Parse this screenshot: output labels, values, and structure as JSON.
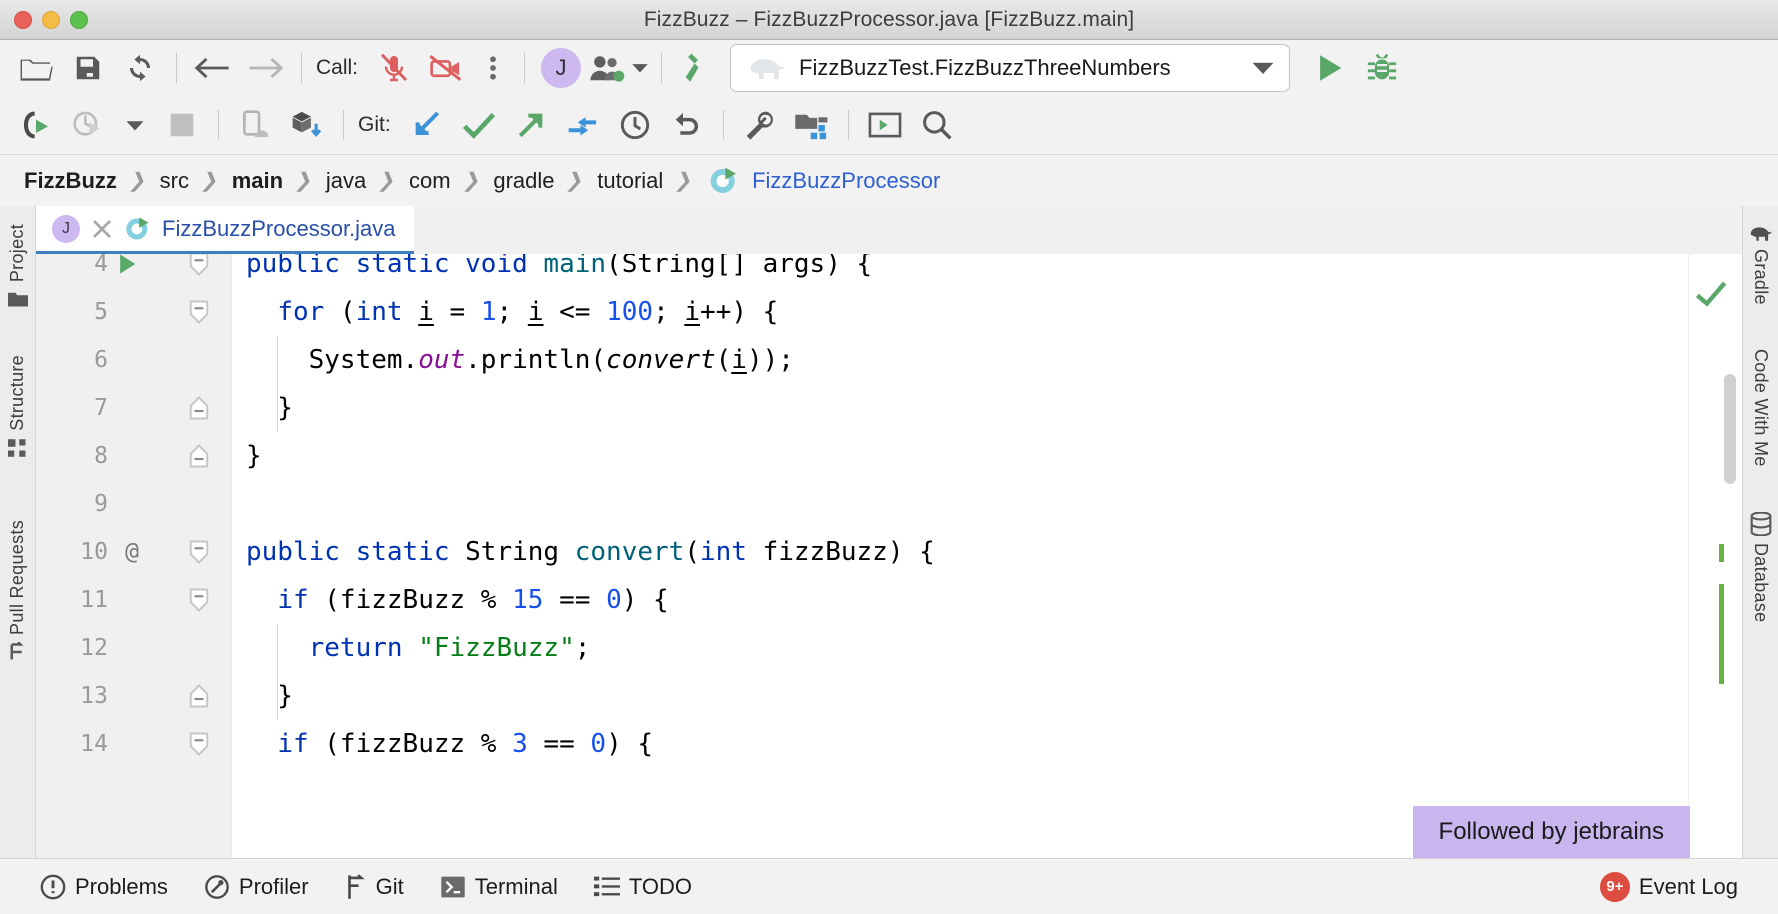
{
  "window": {
    "title": "FizzBuzz – FizzBuzzProcessor.java [FizzBuzz.main]",
    "controls": [
      "close-button",
      "minimize-button",
      "zoom-button"
    ]
  },
  "toolbar_row1": {
    "buttons": [
      {
        "name": "open-folder-icon",
        "label": "Open"
      },
      {
        "name": "save-all-icon",
        "label": "Save All"
      },
      {
        "name": "sync-icon",
        "label": "Reload All from Disk"
      },
      {
        "name": "back-arrow-icon",
        "label": "Back"
      },
      {
        "name": "forward-arrow-icon",
        "label": "Forward"
      }
    ],
    "call_label": "Call:",
    "call_buttons": [
      {
        "name": "microphone-muted-icon",
        "label": "Mute Microphone"
      },
      {
        "name": "camera-off-icon",
        "label": "Turn Off Camera"
      },
      {
        "name": "more-options-icon",
        "label": "More"
      }
    ],
    "avatar_initial": "J",
    "users_icon_label": "Code With Me Participants",
    "build_icon_label": "Build Project",
    "run_config": {
      "icon": "gradle-elephant-icon",
      "name": "FizzBuzzTest.FizzBuzzThreeNumbers",
      "dropdown": "chevron-down-icon"
    },
    "run_button_label": "Run",
    "debug_button_label": "Debug"
  },
  "toolbar_row2": {
    "buttons": [
      {
        "name": "run-with-coverage-icon",
        "label": "Run with Coverage"
      },
      {
        "name": "profiler-run-icon",
        "label": "Profile"
      },
      {
        "name": "profiler-dropdown-icon",
        "label": "Profiler Options"
      },
      {
        "name": "stop-icon",
        "label": "Stop"
      },
      {
        "name": "device-manager-icon",
        "label": "Device Manager"
      },
      {
        "name": "sdk-manager-icon",
        "label": "SDK Manager"
      }
    ],
    "git_label": "Git:",
    "git_buttons": [
      {
        "name": "git-update-icon",
        "label": "Update Project"
      },
      {
        "name": "git-commit-icon",
        "label": "Commit"
      },
      {
        "name": "git-push-icon",
        "label": "Push"
      },
      {
        "name": "git-merge-icon",
        "label": "Merge"
      },
      {
        "name": "git-history-icon",
        "label": "History"
      },
      {
        "name": "git-rollback-icon",
        "label": "Rollback"
      }
    ],
    "tail_buttons": [
      {
        "name": "settings-wrench-icon",
        "label": "Settings"
      },
      {
        "name": "project-structure-icon",
        "label": "Project Structure"
      },
      {
        "name": "terminal-icon",
        "label": "Terminal"
      },
      {
        "name": "search-icon",
        "label": "Search Everywhere"
      }
    ]
  },
  "breadcrumb": {
    "items": [
      {
        "label": "FizzBuzz",
        "style": "bold"
      },
      {
        "label": "src",
        "style": "normal"
      },
      {
        "label": "main",
        "style": "bold"
      },
      {
        "label": "java",
        "style": "normal"
      },
      {
        "label": "com",
        "style": "normal"
      },
      {
        "label": "gradle",
        "style": "normal"
      },
      {
        "label": "tutorial",
        "style": "normal"
      }
    ],
    "class_item": "FizzBuzzProcessor",
    "separator": "›"
  },
  "editor": {
    "tab": {
      "avatar_initial": "J",
      "close_label": "×",
      "filename": "FizzBuzzProcessor.java"
    },
    "lines": [
      {
        "num": "4",
        "marker": "",
        "run": true,
        "fold": "minus",
        "html": "<span class=\"kw\">public static void</span> <span class=\"meth\">main</span>(String[] args) {",
        "indent": 0
      },
      {
        "num": "5",
        "marker": "",
        "run": false,
        "fold": "minus",
        "html": "  <span class=\"kw\">for</span> (<span class=\"kw\">int</span> <span class=\"u\">i</span> = <span class=\"num\">1</span>; <span class=\"u\">i</span> &lt;= <span class=\"num\">100</span>; <span class=\"u\">i</span>++) {",
        "indent": 0
      },
      {
        "num": "6",
        "marker": "",
        "run": false,
        "fold": "",
        "html": "    System.<span class=\"italic-p\">out</span>.println(<span class=\"italic-b\">convert</span>(<span class=\"u\">i</span>));",
        "indent": 1
      },
      {
        "num": "7",
        "marker": "",
        "run": false,
        "fold": "end",
        "html": "  }",
        "indent": 1
      },
      {
        "num": "8",
        "marker": "",
        "run": false,
        "fold": "end",
        "html": "}",
        "indent": 0
      },
      {
        "num": "9",
        "marker": "",
        "run": false,
        "fold": "",
        "html": "",
        "indent": 0
      },
      {
        "num": "10",
        "marker": "@",
        "run": false,
        "fold": "minus",
        "html": "<span class=\"kw\">public static</span> String <span class=\"meth\">convert</span>(<span class=\"kw\">int</span> fizzBuzz) {",
        "indent": 0
      },
      {
        "num": "11",
        "marker": "",
        "run": false,
        "fold": "minus",
        "html": "  <span class=\"kw\">if</span> (fizzBuzz % <span class=\"num\">15</span> == <span class=\"num\">0</span>) {",
        "indent": 0
      },
      {
        "num": "12",
        "marker": "",
        "run": false,
        "fold": "",
        "html": "    <span class=\"kw\">return</span> <span class=\"str\">\"FizzBuzz\"</span>;",
        "indent": 1
      },
      {
        "num": "13",
        "marker": "",
        "run": false,
        "fold": "end",
        "html": "  }",
        "indent": 1
      },
      {
        "num": "14",
        "marker": "",
        "run": false,
        "fold": "minus",
        "html": "  <span class=\"kw\">if</span> (fizzBuzz % <span class=\"num\">3</span> == <span class=\"num\">0</span>) {",
        "indent": 0
      }
    ],
    "inspection_ok": "no-errors-check-icon",
    "tooltip": "Followed by jetbrains"
  },
  "left_strip": {
    "items": [
      {
        "label": "Project",
        "icon": "project-icon"
      },
      {
        "label": "Structure",
        "icon": "structure-icon"
      },
      {
        "label": "Pull Requests",
        "icon": "pull-requests-icon"
      }
    ]
  },
  "right_strip": {
    "items": [
      {
        "label": "Gradle",
        "icon": "gradle-elephant-icon"
      },
      {
        "label": "Code With Me",
        "icon": ""
      },
      {
        "label": "Database",
        "icon": "database-icon"
      }
    ]
  },
  "statusbar": {
    "left_items": [
      {
        "label": "Problems",
        "icon": "problems-icon"
      },
      {
        "label": "Profiler",
        "icon": "profiler-icon"
      },
      {
        "label": "Git",
        "icon": "git-branch-icon"
      },
      {
        "label": "Terminal",
        "icon": "terminal-icon"
      },
      {
        "label": "TODO",
        "icon": "todo-list-icon"
      }
    ],
    "event_log": {
      "label": "Event Log",
      "badge": "9+"
    }
  },
  "colors": {
    "accent_blue": "#3d7ebf",
    "keyword": "#0033b3",
    "number": "#1750eb",
    "string": "#067d17",
    "method": "#00627a",
    "field_italic": "#871094",
    "green_run": "#59a869",
    "red_alert": "#dc4c3f",
    "tooltip_bg": "#c9b6ef",
    "avatar_bg": "#cdb8f0"
  }
}
